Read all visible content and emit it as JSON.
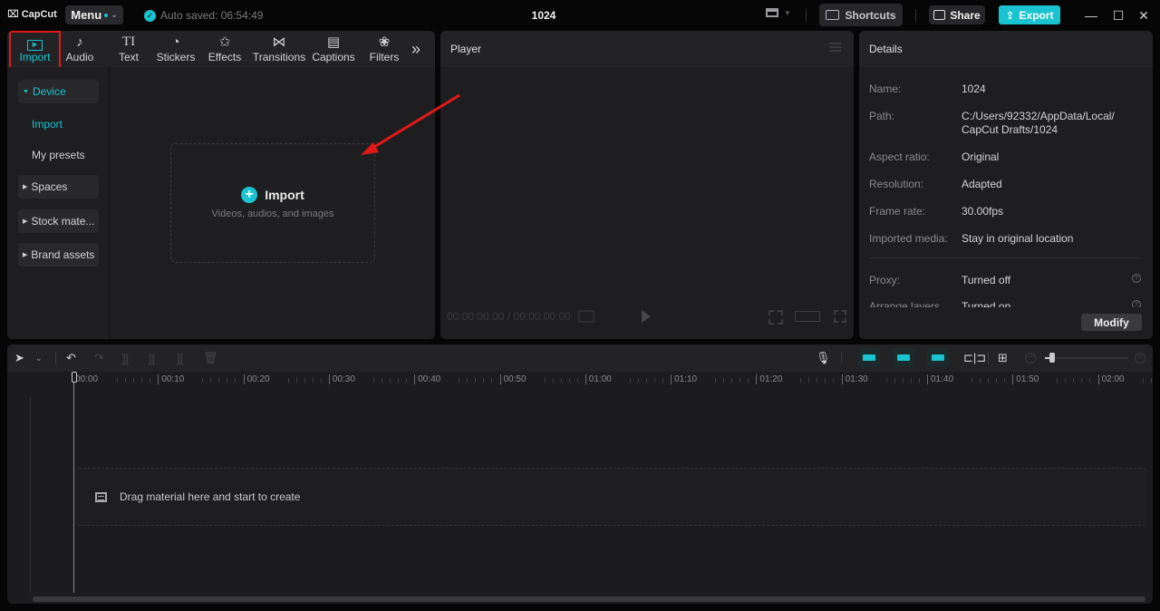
{
  "titlebar": {
    "logo": "CapCut",
    "menu_label": "Menu",
    "autosave": "Auto saved: 06:54:49",
    "doc_title": "1024",
    "shortcuts_label": "Shortcuts",
    "share_label": "Share",
    "export_label": "Export",
    "window_controls": {
      "minimize": "—",
      "maximize": "☐",
      "close": "✕"
    },
    "accent_color": "#19c3cf"
  },
  "media": {
    "tabs": [
      {
        "label": "Import",
        "icon": "import-icon",
        "glyph": "▣",
        "active": true
      },
      {
        "label": "Audio",
        "icon": "audio-icon",
        "glyph": "♪"
      },
      {
        "label": "Text",
        "icon": "text-icon",
        "glyph": "TI"
      },
      {
        "label": "Stickers",
        "icon": "stickers-icon",
        "glyph": "◔"
      },
      {
        "label": "Effects",
        "icon": "effects-icon",
        "glyph": "✩"
      },
      {
        "label": "Transitions",
        "icon": "transitions-icon",
        "glyph": "⋈"
      },
      {
        "label": "Captions",
        "icon": "captions-icon",
        "glyph": "▤"
      },
      {
        "label": "Filters",
        "icon": "filters-icon",
        "glyph": "❀"
      }
    ],
    "more_glyph": "»",
    "sidenav": {
      "device": "Device",
      "import": "Import",
      "my_presets": "My presets",
      "spaces": "Spaces",
      "stock": "Stock mate...",
      "brand": "Brand assets"
    },
    "import_zone": {
      "title": "Import",
      "subtitle": "Videos, audios, and images"
    }
  },
  "player": {
    "title": "Player",
    "timecode": "00:00:00:00 / 00:00:00:00"
  },
  "details": {
    "title": "Details",
    "rows": [
      {
        "label": "Name:",
        "value": "1024"
      },
      {
        "label": "Path:",
        "value": "C:/Users/92332/AppData/Local/ CapCut Drafts/1024"
      },
      {
        "label": "Aspect ratio:",
        "value": "Original"
      },
      {
        "label": "Resolution:",
        "value": "Adapted"
      },
      {
        "label": "Frame rate:",
        "value": "30.00fps"
      },
      {
        "label": "Imported media:",
        "value": "Stay in original location"
      },
      {
        "label": "Proxy:",
        "value": "Turned off"
      },
      {
        "label": "Arrange layers",
        "value": "Turned on"
      }
    ],
    "modify_label": "Modify"
  },
  "timeline": {
    "ruler": [
      "00:00",
      "00:10",
      "00:20",
      "00:30",
      "00:40",
      "00:50",
      "01:00",
      "01:10",
      "01:20",
      "01:30",
      "01:40",
      "01:50",
      "02:00"
    ],
    "drop_text": "Drag material here and start to create"
  }
}
